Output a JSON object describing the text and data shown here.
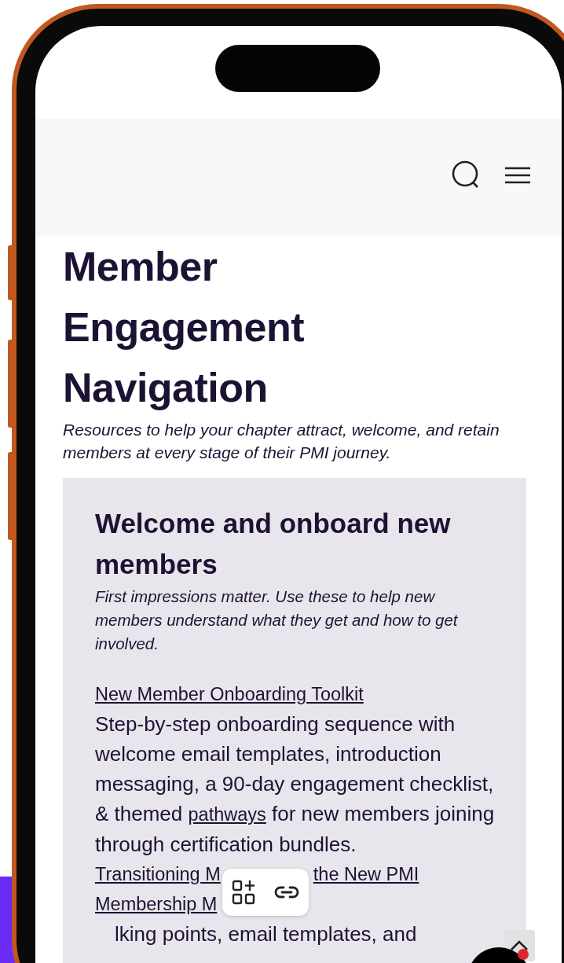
{
  "page": {
    "title": "Member Engagement Navigation",
    "subtitle": "Resources to help your chapter attract, welcome, and retain members at every stage of their PMI journey."
  },
  "section": {
    "heading": "Welcome and onboard new members",
    "intro": "First impressions matter. Use these to help new members understand what they get and how to get involved.",
    "resources": [
      {
        "kind": "full",
        "link": "New Member Onboarding Toolkit",
        "description_before": "Step-by-step onboarding sequence with welcome email templates, introduction messaging, a 90-day engagement checklist, & themed ",
        "inline_link": "pathways",
        "description_after": " for new members joining through certification bundles."
      },
      {
        "kind": "covered",
        "link_start": "Transitioning M",
        "link_end": "the New PMI",
        "link_line_2": "Membership M",
        "description": "lking points, email templates, and"
      }
    ]
  }
}
